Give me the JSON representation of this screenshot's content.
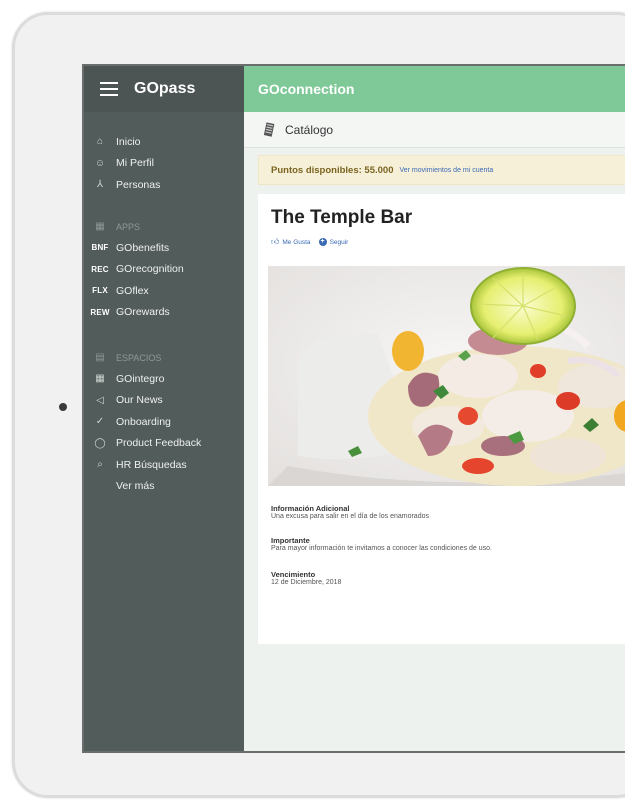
{
  "sidebar": {
    "brand": "GOpass",
    "main_items": [
      {
        "icon": "home-icon",
        "glyph": "⌂",
        "label": "Inicio"
      },
      {
        "icon": "profile-icon",
        "glyph": "☺",
        "label": "Mi Perfil"
      },
      {
        "icon": "people-icon",
        "glyph": "⅄",
        "label": "Personas"
      }
    ],
    "apps_section": "APPS",
    "apps": [
      {
        "abbr": "BNF",
        "label": "GObenefits"
      },
      {
        "abbr": "REC",
        "label": "GOrecognition"
      },
      {
        "abbr": "FLX",
        "label": "GOflex"
      },
      {
        "abbr": "REW",
        "label": "GOrewards"
      }
    ],
    "spaces_section": "ESPACIOS",
    "spaces": [
      {
        "icon": "building-icon",
        "glyph": "▦",
        "label": "GOintegro"
      },
      {
        "icon": "megaphone-icon",
        "glyph": "◁",
        "label": "Our News"
      },
      {
        "icon": "check-circle-icon",
        "glyph": "✓",
        "label": "Onboarding"
      },
      {
        "icon": "chat-bubble-icon",
        "glyph": "◯",
        "label": "Product Feedback"
      },
      {
        "icon": "search-icon",
        "glyph": "⌕",
        "label": "HR Búsquedas"
      }
    ],
    "more": "Ver más"
  },
  "header": {
    "title": "GOconnection",
    "section": "Catálogo"
  },
  "points": {
    "text": "Puntos disponibles: 55.000",
    "link": "Ver movimientos de mi cuenta"
  },
  "item": {
    "title": "The Temple Bar",
    "like": "Me Gusta",
    "follow": "Seguir",
    "info_label": "Información Adicional",
    "info_value": "Una excusa para salir en el día de los enamorados",
    "important_label": "Importante",
    "important_value": "Para mayor información te invitamos a conocer las condiciones de uso.",
    "expiry_label": "Vencimiento",
    "expiry_value": "12 de Diciembre, 2018"
  },
  "colors": {
    "header_green": "#7fc897",
    "sidebar": "#525c5a",
    "points_bg": "#f7f0d8",
    "link_blue": "#3b6ab5"
  }
}
